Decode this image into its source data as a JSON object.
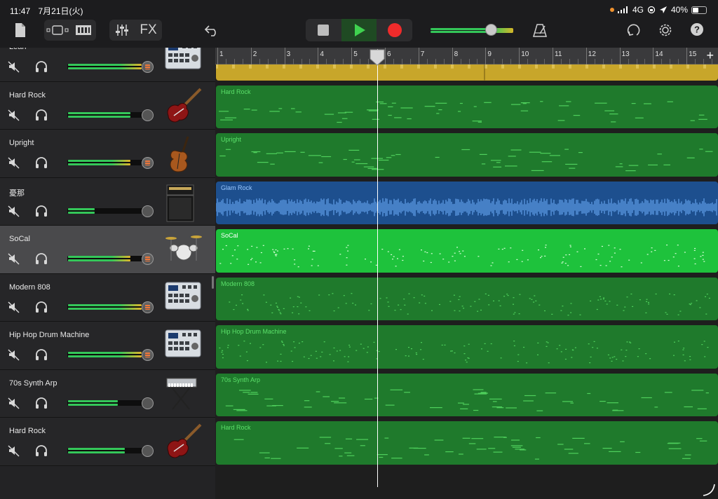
{
  "status_bar": {
    "time": "11:47",
    "date": "7月21日(火)",
    "network": "4G",
    "battery": "40%"
  },
  "toolbar": {
    "fx_label": "FX"
  },
  "ruler": {
    "bars": [
      "1",
      "2",
      "3",
      "4",
      "5",
      "6",
      "7",
      "8",
      "9",
      "10",
      "11",
      "12",
      "13",
      "14",
      "15"
    ],
    "add_label": "+"
  },
  "tracks": [
    {
      "name": "Lean",
      "instrument": "drum-machine-icon",
      "volume": 0.97,
      "hot": true
    },
    {
      "name": "Hard Rock",
      "instrument": "electric-guitar-icon",
      "volume": 0.82,
      "hot": false
    },
    {
      "name": "Upright",
      "instrument": "upright-bass-icon",
      "volume": 0.82,
      "hot": true
    },
    {
      "name": "憂那",
      "instrument": "amp-stack-icon",
      "volume": 0.35,
      "hot": false
    },
    {
      "name": "SoCal",
      "instrument": "drum-kit-icon",
      "volume": 0.82,
      "hot": true
    },
    {
      "name": "Modern 808",
      "instrument": "drum-machine-icon",
      "volume": 0.97,
      "hot": true
    },
    {
      "name": "Hip Hop Drum Machine",
      "instrument": "drum-machine-icon",
      "volume": 0.97,
      "hot": true
    },
    {
      "name": "70s Synth Arp",
      "instrument": "keyboard-synth-icon",
      "volume": 0.66,
      "hot": false
    },
    {
      "name": "Hard Rock",
      "instrument": "electric-guitar-icon",
      "volume": 0.75,
      "hot": false
    }
  ],
  "regions": [
    {
      "label": "",
      "kind": "audio",
      "color": "#c8a62a"
    },
    {
      "label": "Hard Rock",
      "kind": "midi",
      "color": "#1f7a2c"
    },
    {
      "label": "Upright",
      "kind": "midi",
      "color": "#1f7a2c"
    },
    {
      "label": "Glam Rock",
      "kind": "audio",
      "color": "#1d4f8e"
    },
    {
      "label": "SoCal",
      "kind": "drums",
      "color": "#1ec23c"
    },
    {
      "label": "Modern 808",
      "kind": "drums",
      "color": "#1f7a2c"
    },
    {
      "label": "Hip Hop Drum Machine",
      "kind": "drums",
      "color": "#1f7a2c"
    },
    {
      "label": "70s Synth Arp",
      "kind": "midi",
      "color": "#1f7a2c"
    },
    {
      "label": "Hard Rock",
      "kind": "midi",
      "color": "#1f7a2c"
    }
  ],
  "colors": {
    "green_meter": "#34c759",
    "yellow_meter": "#e2b42a",
    "selected_row": "#4a4a4c"
  }
}
